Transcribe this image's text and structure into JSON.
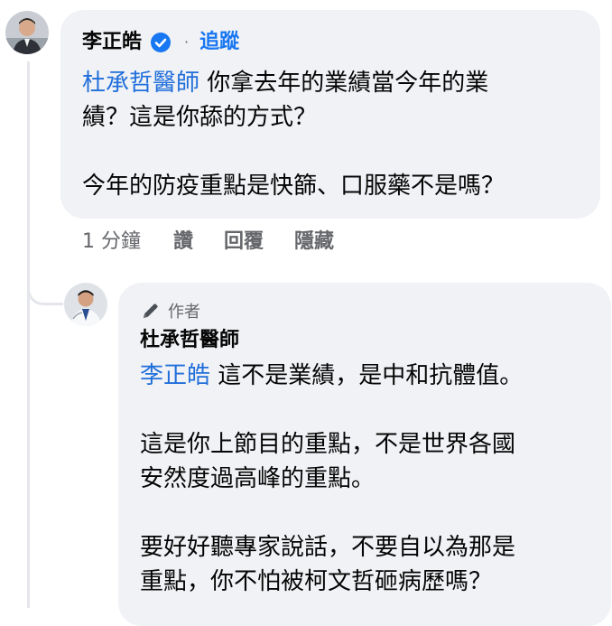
{
  "main_comment": {
    "author": "李正皓",
    "separator": "·",
    "follow_label": "追蹤",
    "mention": "杜承哲醫師",
    "line1_rest": " 你拿去年的業績當今年的業",
    "line2": "績？這是你舔的方式？",
    "line3": "今年的防疫重點是快篩、口服藥不是嗎？"
  },
  "actions": {
    "time": "1 分鐘",
    "like": "讚",
    "reply": "回覆",
    "hide": "隱藏"
  },
  "reply_comment": {
    "badge": "作者",
    "author": "杜承哲醫師",
    "mention": "李正皓",
    "line1_rest": " 這不是業績，是中和抗體值。",
    "line2": "這是你上節目的重點，不是世界各國",
    "line3": "安然度過高峰的重點。",
    "line4": "要好好聽專家說話，不要自以為那是",
    "line5": "重點，你不怕被柯文哲砸病歷嗎？"
  },
  "icons": {
    "verified": "verified-badge-icon",
    "author_badge": "pencil-icon"
  },
  "colors": {
    "link_blue": "#1877f2",
    "mention_blue": "#216fdb",
    "bubble_bg": "#f0f2f5",
    "meta_gray": "#65676b"
  }
}
